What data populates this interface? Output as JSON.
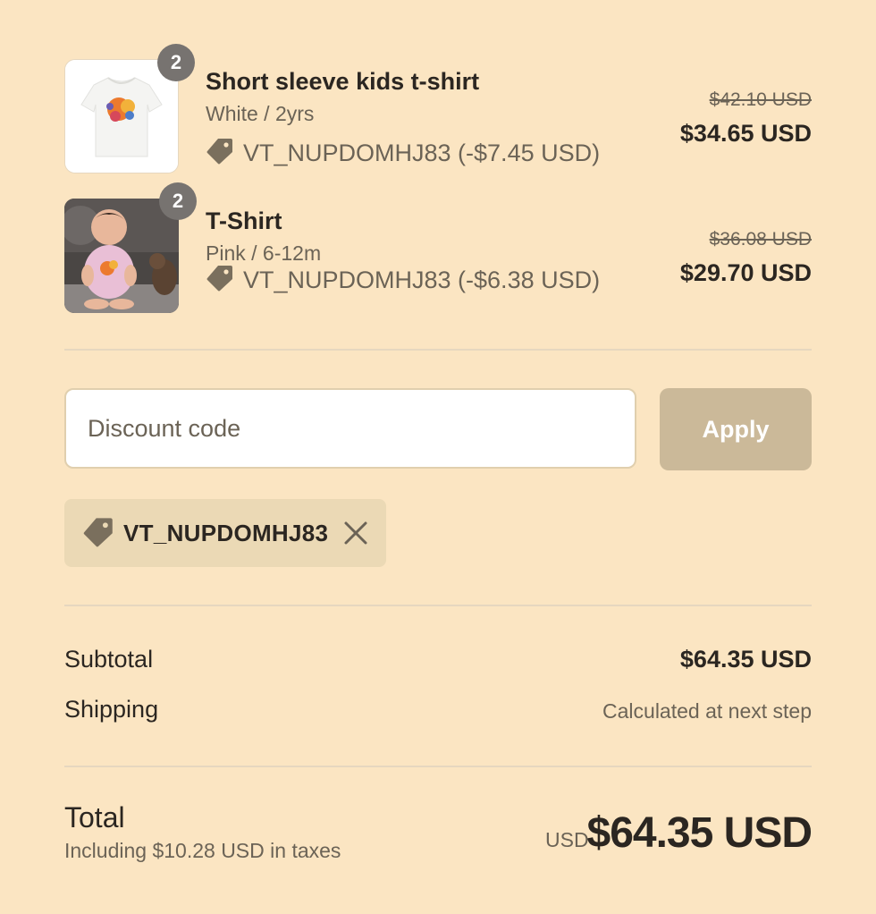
{
  "items": [
    {
      "title": "Short sleeve kids t-shirt",
      "variant": "White / 2yrs",
      "quantity": "2",
      "discount": "VT_NUPDOMHJ83 (-$7.45 USD)",
      "original_price": "$42.10 USD",
      "price": "$34.65 USD"
    },
    {
      "title": "T-Shirt",
      "variant": "Pink / 6-12m",
      "quantity": "2",
      "discount": "VT_NUPDOMHJ83 (-$6.38 USD)",
      "original_price": "$36.08 USD",
      "price": "$29.70 USD"
    }
  ],
  "discount": {
    "placeholder": "Discount code",
    "apply_label": "Apply",
    "applied_code": "VT_NUPDOMHJ83"
  },
  "summary": {
    "subtotal_label": "Subtotal",
    "subtotal_value": "$64.35 USD",
    "shipping_label": "Shipping",
    "shipping_value": "Calculated at next step",
    "total_label": "Total",
    "tax_note": "Including $10.28 USD in taxes",
    "currency": "USD",
    "total_value": "$64.35 USD"
  },
  "colors": {
    "background": "#fbe5c2",
    "apply_button": "#cbb999",
    "chip": "#ebd9b5",
    "badge": "#777370"
  },
  "icons": [
    "tag-icon",
    "close-icon"
  ]
}
